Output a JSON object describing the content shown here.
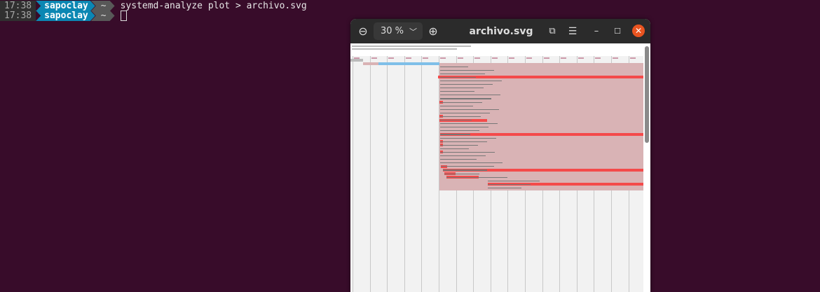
{
  "terminal": {
    "lines": [
      {
        "time": "17:38",
        "user": "sapoclay",
        "dir": "~",
        "command": "systemd-analyze plot > archivo.svg"
      },
      {
        "time": "17:38",
        "user": "sapoclay",
        "dir": "~",
        "command": ""
      }
    ]
  },
  "viewer": {
    "zoom_level": "30 %",
    "title": "archivo.svg",
    "icons": [
      "zoom-out-icon",
      "chevron-down-icon",
      "zoom-in-icon",
      "fullscreen-icon",
      "menu-icon",
      "minimize-icon",
      "maximize-icon",
      "close-icon"
    ]
  },
  "colors": {
    "terminal_bg": "#380c2a",
    "user_segment": "#0b87b3",
    "close_button": "#e95420",
    "plot_active": "#f44a4a",
    "plot_inactive": "#d9b3b5",
    "plot_kernel": "#7fbfe8"
  }
}
